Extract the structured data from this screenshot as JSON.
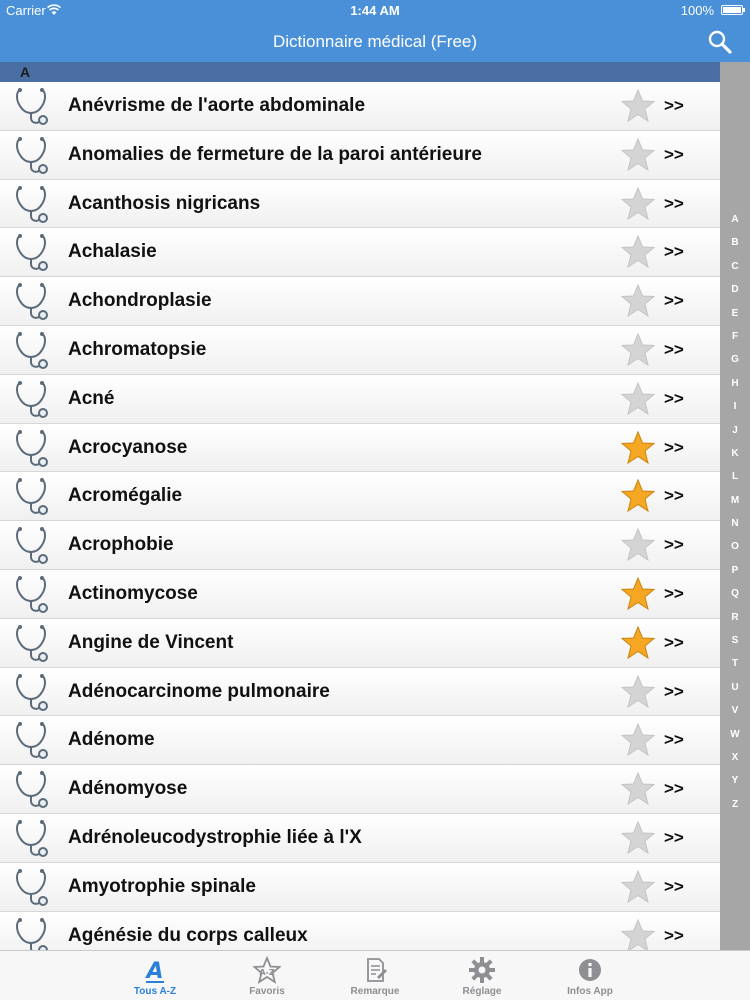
{
  "status_bar": {
    "carrier": "Carrier",
    "time": "1:44 AM",
    "battery": "100%"
  },
  "nav": {
    "title": "Dictionnaire médical (Free)"
  },
  "section": {
    "letter": "A"
  },
  "entries": [
    {
      "name": "Anévrisme de l'aorte abdominale",
      "favorite": false
    },
    {
      "name": "Anomalies de fermeture de la paroi antérieure",
      "favorite": false
    },
    {
      "name": "Acanthosis nigricans",
      "favorite": false
    },
    {
      "name": "Achalasie",
      "favorite": false
    },
    {
      "name": "Achondroplasie",
      "favorite": false
    },
    {
      "name": "Achromatopsie",
      "favorite": false
    },
    {
      "name": "Acné",
      "favorite": false
    },
    {
      "name": "Acrocyanose",
      "favorite": true
    },
    {
      "name": "Acromégalie",
      "favorite": true
    },
    {
      "name": "Acrophobie",
      "favorite": false
    },
    {
      "name": "Actinomycose",
      "favorite": true
    },
    {
      "name": "Angine de Vincent",
      "favorite": true
    },
    {
      "name": "Adénocarcinome pulmonaire",
      "favorite": false
    },
    {
      "name": "Adénome",
      "favorite": false
    },
    {
      "name": "Adénomyose",
      "favorite": false
    },
    {
      "name": "Adrénoleucodystrophie liée à l'X",
      "favorite": false
    },
    {
      "name": "Amyotrophie spinale",
      "favorite": false
    },
    {
      "name": "Agénésie du corps calleux",
      "favorite": false
    }
  ],
  "row_chevron": ">>",
  "index_letters": [
    "A",
    "B",
    "C",
    "D",
    "E",
    "F",
    "G",
    "H",
    "I",
    "J",
    "K",
    "L",
    "M",
    "N",
    "O",
    "P",
    "Q",
    "R",
    "S",
    "T",
    "U",
    "V",
    "W",
    "X",
    "Y",
    "Z"
  ],
  "tabs": [
    {
      "label": "Tous A-Z",
      "icon": "letter-a-icon",
      "active": true
    },
    {
      "label": "Favoris",
      "icon": "star-tab-icon",
      "active": false
    },
    {
      "label": "Remarque",
      "icon": "note-icon",
      "active": false
    },
    {
      "label": "Réglage",
      "icon": "gear-icon",
      "active": false
    },
    {
      "label": "Infos App",
      "icon": "info-icon",
      "active": false
    }
  ],
  "colors": {
    "accent": "#4a90d9",
    "section_header": "#4a6fa5",
    "favorite_star": "#f5a623",
    "inactive_star": "#d4d4d4",
    "index_bar": "#a6a6a6",
    "tab_active": "#2a7fd9"
  }
}
